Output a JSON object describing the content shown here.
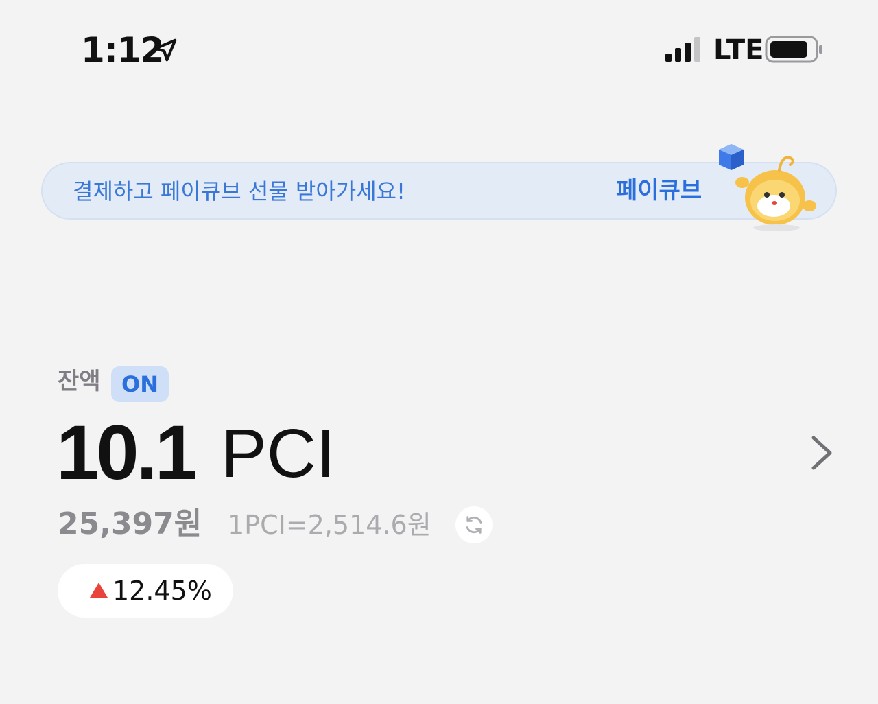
{
  "status_bar": {
    "time": "1:12",
    "network": "LTE",
    "location_icon": "location-arrow-icon",
    "signal_icon": "signal-bars-icon",
    "battery_icon": "battery-icon"
  },
  "promo": {
    "message": "결제하고 페이큐브 선물 받아가세요!",
    "brand": "페이큐브",
    "mascot": "cube-mascot"
  },
  "balance": {
    "label": "잔액",
    "badge": "ON",
    "amount": "10.1",
    "unit": "PCI",
    "krw_value": "25,397원",
    "rate": "1PCI=2,514.6원",
    "change": "12.45%",
    "change_direction": "up"
  },
  "colors": {
    "accent_blue": "#2a6fdc",
    "up_red": "#e8443a",
    "background": "#f3f3f4"
  }
}
